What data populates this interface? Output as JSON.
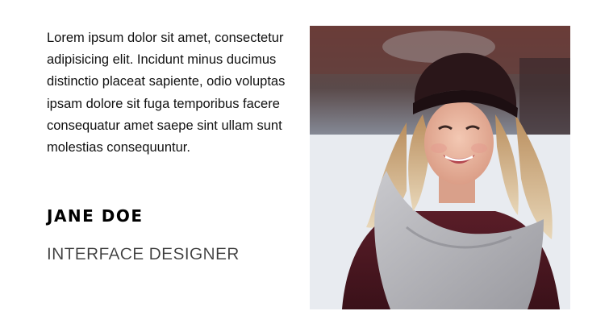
{
  "profile": {
    "quote": "Lorem ipsum dolor sit amet, consectetur adipisicing elit. Incidunt minus ducimus distinctio placeat sapiente, odio voluptas ipsam dolore sit fuga temporibus facere consequatur amet saepe sint ullam sunt molestias consequuntur.",
    "name": "JANE DOE",
    "role": "INTERFACE DESIGNER"
  }
}
